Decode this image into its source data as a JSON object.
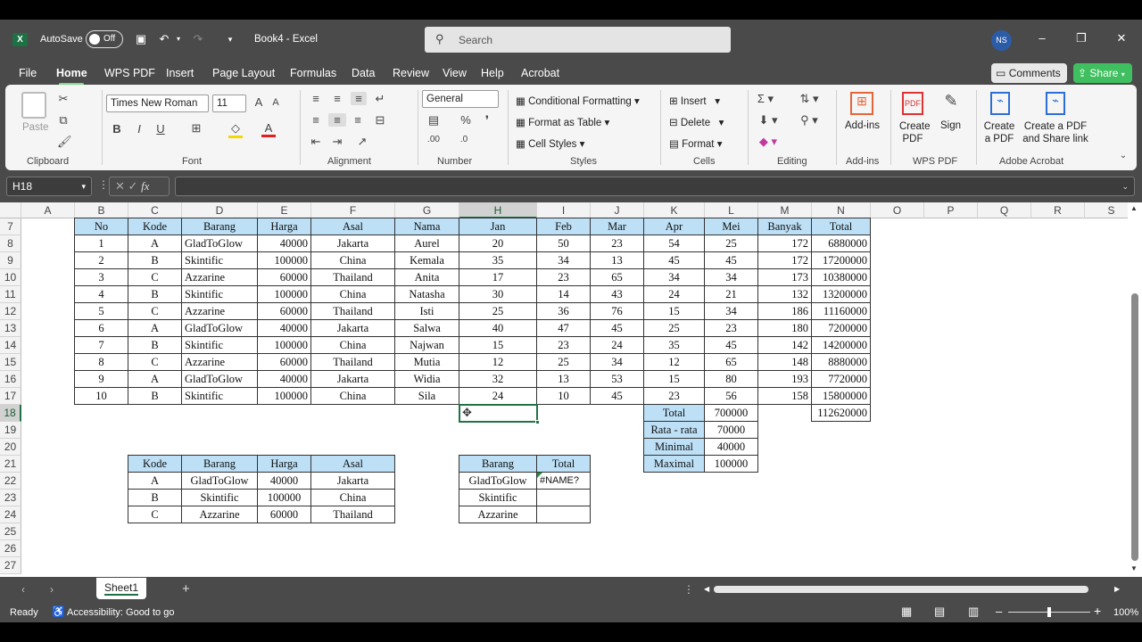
{
  "titlebar": {
    "autosave": "AutoSave",
    "autosave_state": "Off",
    "filename": "Book4 - Excel",
    "search_placeholder": "Search",
    "user_initials": "NS"
  },
  "menu": {
    "tabs": [
      "File",
      "Home",
      "WPS PDF",
      "Insert",
      "Page Layout",
      "Formulas",
      "Data",
      "Review",
      "View",
      "Help",
      "Acrobat"
    ],
    "comments": "Comments",
    "share": "Share"
  },
  "ribbon": {
    "clipboard": {
      "paste": "Paste",
      "label": "Clipboard"
    },
    "font": {
      "name": "Times New Roman",
      "size": "11",
      "label": "Font",
      "bold": "B",
      "italic": "I",
      "underline": "U"
    },
    "alignment": {
      "label": "Alignment"
    },
    "number": {
      "format": "General",
      "label": "Number"
    },
    "styles": {
      "cond": "Conditional Formatting",
      "table": "Format as Table",
      "cell": "Cell Styles",
      "label": "Styles"
    },
    "cells": {
      "insert": "Insert",
      "delete": "Delete",
      "format": "Format",
      "label": "Cells"
    },
    "editing": {
      "label": "Editing"
    },
    "addins": {
      "btn": "Add-ins",
      "label": "Add-ins"
    },
    "wps": {
      "create": "Create PDF",
      "sign": "Sign",
      "label": "WPS PDF"
    },
    "acrobat": {
      "create": "Create a PDF",
      "share": "Create a PDF and Share link",
      "label": "Adobe Acrobat"
    }
  },
  "formula_bar": {
    "namebox": "H18",
    "formula": ""
  },
  "columns": [
    "A",
    "B",
    "C",
    "D",
    "E",
    "F",
    "G",
    "H",
    "I",
    "J",
    "K",
    "L",
    "M",
    "N",
    "O",
    "P",
    "Q",
    "R",
    "S"
  ],
  "rows": [
    "7",
    "8",
    "9",
    "10",
    "11",
    "12",
    "13",
    "14",
    "15",
    "16",
    "17",
    "18",
    "19",
    "20",
    "21",
    "22",
    "23",
    "24",
    "25",
    "26",
    "27"
  ],
  "main_table": {
    "headers": [
      "No",
      "Kode",
      "Barang",
      "Harga",
      "Asal",
      "Nama",
      "Jan",
      "Feb",
      "Mar",
      "Apr",
      "Mei",
      "Banyak",
      "Total"
    ],
    "rows": [
      [
        "1",
        "A",
        "GladToGlow",
        "40000",
        "Jakarta",
        "Aurel",
        "20",
        "50",
        "23",
        "54",
        "25",
        "172",
        "6880000"
      ],
      [
        "2",
        "B",
        "Skintific",
        "100000",
        "China",
        "Kemala",
        "35",
        "34",
        "13",
        "45",
        "45",
        "172",
        "17200000"
      ],
      [
        "3",
        "C",
        "Azzarine",
        "60000",
        "Thailand",
        "Anita",
        "17",
        "23",
        "65",
        "34",
        "34",
        "173",
        "10380000"
      ],
      [
        "4",
        "B",
        "Skintific",
        "100000",
        "China",
        "Natasha",
        "30",
        "14",
        "43",
        "24",
        "21",
        "132",
        "13200000"
      ],
      [
        "5",
        "C",
        "Azzarine",
        "60000",
        "Thailand",
        "Isti",
        "25",
        "36",
        "76",
        "15",
        "34",
        "186",
        "11160000"
      ],
      [
        "6",
        "A",
        "GladToGlow",
        "40000",
        "Jakarta",
        "Salwa",
        "40",
        "47",
        "45",
        "25",
        "23",
        "180",
        "7200000"
      ],
      [
        "7",
        "B",
        "Skintific",
        "100000",
        "China",
        "Najwan",
        "15",
        "23",
        "24",
        "35",
        "45",
        "142",
        "14200000"
      ],
      [
        "8",
        "C",
        "Azzarine",
        "60000",
        "Thailand",
        "Mutia",
        "12",
        "25",
        "34",
        "12",
        "65",
        "148",
        "8880000"
      ],
      [
        "9",
        "A",
        "GladToGlow",
        "40000",
        "Jakarta",
        "Widia",
        "32",
        "13",
        "53",
        "15",
        "80",
        "193",
        "7720000"
      ],
      [
        "10",
        "B",
        "Skintific",
        "100000",
        "China",
        "Sila",
        "24",
        "10",
        "45",
        "23",
        "56",
        "158",
        "15800000"
      ]
    ],
    "grand_total": "112620000"
  },
  "stats": [
    [
      "Total",
      "700000"
    ],
    [
      "Rata - rata",
      "70000"
    ],
    [
      "Minimal",
      "40000"
    ],
    [
      "Maximal",
      "100000"
    ]
  ],
  "lookup": {
    "headers": [
      "Kode",
      "Barang",
      "Harga",
      "Asal"
    ],
    "rows": [
      [
        "A",
        "GladToGlow",
        "40000",
        "Jakarta"
      ],
      [
        "B",
        "Skintific",
        "100000",
        "China"
      ],
      [
        "C",
        "Azzarine",
        "60000",
        "Thailand"
      ]
    ]
  },
  "summary": {
    "headers": [
      "Barang",
      "Total"
    ],
    "rows": [
      [
        "GladToGlow",
        "#NAME?"
      ],
      [
        "Skintific",
        ""
      ],
      [
        "Azzarine",
        ""
      ]
    ]
  },
  "sheet_tabs": {
    "active": "Sheet1"
  },
  "statusbar": {
    "ready": "Ready",
    "accessibility": "Accessibility: Good to go",
    "zoom": "100%"
  },
  "colors": {
    "header_fill": "#bde0f6",
    "accent_green": "#217346",
    "share_green": "#3fbf5f"
  }
}
